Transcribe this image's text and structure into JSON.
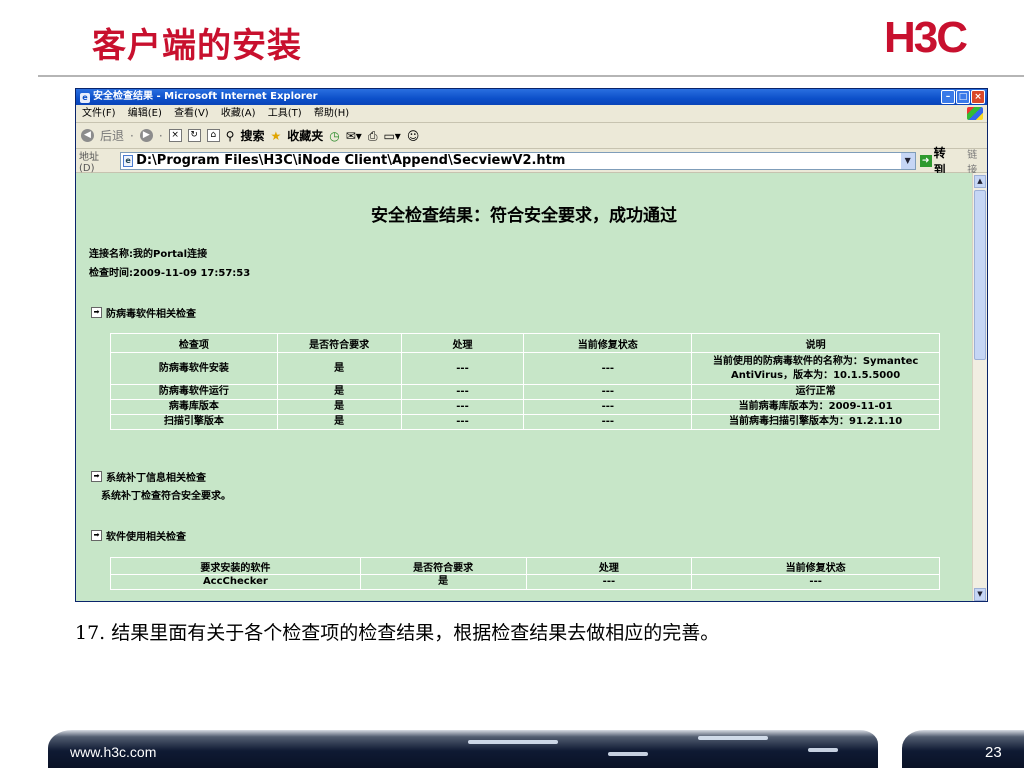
{
  "slide": {
    "title": "客户端的安装",
    "logo": "H3C",
    "caption": "17. 结果里面有关于各个检查项的检查结果，根据检查结果去做相应的完善。",
    "footer_url": "www.h3c.com",
    "page_number": "23"
  },
  "browser": {
    "window_title": "安全检查结果 - Microsoft Internet Explorer",
    "menu": [
      "文件(F)",
      "编辑(E)",
      "查看(V)",
      "收藏(A)",
      "工具(T)",
      "帮助(H)"
    ],
    "toolbar": {
      "back": "后退",
      "search": "搜索",
      "favorites": "收藏夹"
    },
    "address_label": "地址(D)",
    "address_value": "D:\\Program Files\\H3C\\iNode Client\\Append\\SecviewV2.htm",
    "go_label": "转到",
    "links_label": "链接"
  },
  "page": {
    "heading": "安全检查结果：符合安全要求，成功通过",
    "connection": "连接名称:我的Portal连接",
    "check_time": "检查时间:2009-11-09 17:57:53",
    "antivirus": {
      "title": "防病毒软件相关检查",
      "headers": [
        "检查项",
        "是否符合要求",
        "处理",
        "当前修复状态",
        "说明"
      ],
      "rows": [
        [
          "防病毒软件安装",
          "是",
          "---",
          "---",
          "当前使用的防病毒软件的名称为：Symantec AntiVirus，版本为：10.1.5.5000"
        ],
        [
          "防病毒软件运行",
          "是",
          "---",
          "---",
          "运行正常"
        ],
        [
          "病毒库版本",
          "是",
          "---",
          "---",
          "当前病毒库版本为：2009-11-01"
        ],
        [
          "扫描引擎版本",
          "是",
          "---",
          "---",
          "当前病毒扫描引擎版本为：91.2.1.10"
        ]
      ]
    },
    "patch": {
      "title": "系统补丁信息相关检查",
      "note": "系统补丁检查符合安全要求。"
    },
    "software": {
      "title": "软件使用相关检查",
      "headers": [
        "要求安装的软件",
        "是否符合要求",
        "处理",
        "当前修复状态"
      ],
      "rows": [
        [
          "AccChecker",
          "是",
          "---",
          "---"
        ]
      ]
    }
  },
  "colors": {
    "brand_red": "#c8102e",
    "page_green": "#c7e6c8",
    "ie_blue": "#0c4fc9"
  }
}
